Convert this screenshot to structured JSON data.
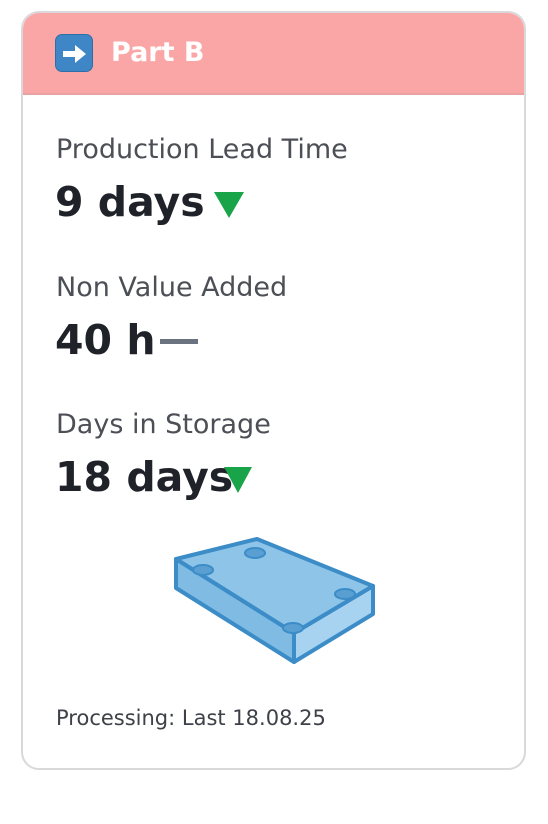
{
  "card": {
    "title": "Part B",
    "header_icon": "right-arrow-icon",
    "header_color": "#fba6a6",
    "metrics": [
      {
        "label": "Production Lead Time",
        "value": "9 days",
        "trend": "down",
        "trend_color": "#1aa44a"
      },
      {
        "label": "Non Value Added",
        "value": "40 h",
        "trend": "flat",
        "trend_color": "#6b7280"
      },
      {
        "label": "Days in Storage",
        "value": "18 days",
        "trend": "down",
        "trend_color": "#1aa44a"
      }
    ],
    "illustration_icon": "part-plate-icon",
    "illustration_color": "#8ec4e8",
    "footer": "Processing: Last 18.08.25"
  }
}
